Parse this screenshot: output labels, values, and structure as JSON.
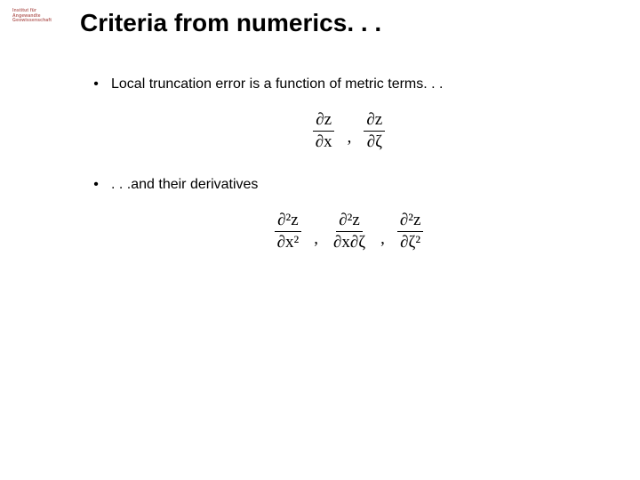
{
  "logo": {
    "line1": "Institut für",
    "line2": "Angewandte",
    "line3": "Geowissenschaft"
  },
  "title": "Criteria from numerics. . .",
  "bullets": [
    {
      "text": "Local truncation error is a function of metric terms. . ."
    },
    {
      "text": ". . .and their derivatives"
    }
  ],
  "equations": {
    "first": {
      "terms": [
        {
          "num": "∂z",
          "den": "∂x"
        },
        {
          "num": "∂z",
          "den": "∂ζ"
        }
      ]
    },
    "second": {
      "terms": [
        {
          "num": "∂²z",
          "den": "∂x²"
        },
        {
          "num": "∂²z",
          "den": "∂x∂ζ"
        },
        {
          "num": "∂²z",
          "den": "∂ζ²"
        }
      ]
    }
  }
}
